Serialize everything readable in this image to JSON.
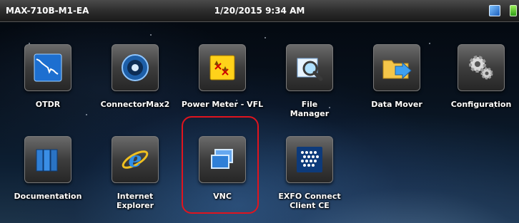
{
  "status_bar": {
    "device_name": "MAX-710B-M1-EA",
    "datetime": "1/20/2015 9:34 AM"
  },
  "apps": {
    "otdr": {
      "label": "OTDR",
      "icon": "otdr-trace-icon"
    },
    "connectormax2": {
      "label": "ConnectorMax2",
      "icon": "connector-icon"
    },
    "power_meter": {
      "label": "Power Meter - VFL",
      "icon": "power-meter-icon"
    },
    "file_manager": {
      "label_line1": "File",
      "label_line2": "Manager",
      "icon": "magnifier-icon"
    },
    "data_mover": {
      "label": "Data Mover",
      "icon": "folder-arrow-icon"
    },
    "configuration": {
      "label": "Configuration",
      "icon": "gears-icon"
    },
    "documentation": {
      "label": "Documentation",
      "icon": "binders-icon"
    },
    "internet_explorer": {
      "label_line1": "Internet",
      "label_line2": "Explorer",
      "icon": "ie-icon"
    },
    "vnc": {
      "label": "VNC",
      "icon": "vnc-windows-icon"
    },
    "exfo_connect": {
      "label_line1": "EXFO Connect",
      "label_line2": "Client CE",
      "icon": "exfo-connect-icon"
    }
  },
  "highlight_color": "#e0141e"
}
